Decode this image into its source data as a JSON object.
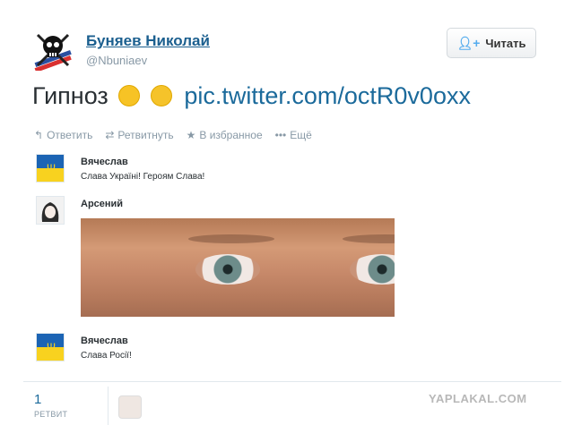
{
  "header": {
    "author_name": "Буняев Николай",
    "author_handle": "@Nbuniaev",
    "follow_label": "Читать"
  },
  "tweet": {
    "text": "Гипноз",
    "link": "pic.twitter.com/octR0v0oxx"
  },
  "actions": [
    {
      "label": "Ответить",
      "icon": "reply-icon"
    },
    {
      "label": "Ретвитнуть",
      "icon": "retweet-icon"
    },
    {
      "label": "В избранное",
      "icon": "star-icon"
    },
    {
      "label": "Ещё",
      "icon": "more-icon"
    }
  ],
  "replies": [
    {
      "name": "Вячеслав",
      "text": "Слава Україні! Героям Слава!"
    },
    {
      "name": "Арсений",
      "text": ""
    },
    {
      "name": "Вячеслав",
      "text": "Слава Росії!"
    }
  ],
  "stats": {
    "retweet_count": "1",
    "retweet_label": "РЕТВИТ"
  },
  "watermark": "YAPLAKAL.COM",
  "colors": {
    "link": "#1b6a9b",
    "name": "#1b5f8f",
    "muted": "#8899a6"
  }
}
